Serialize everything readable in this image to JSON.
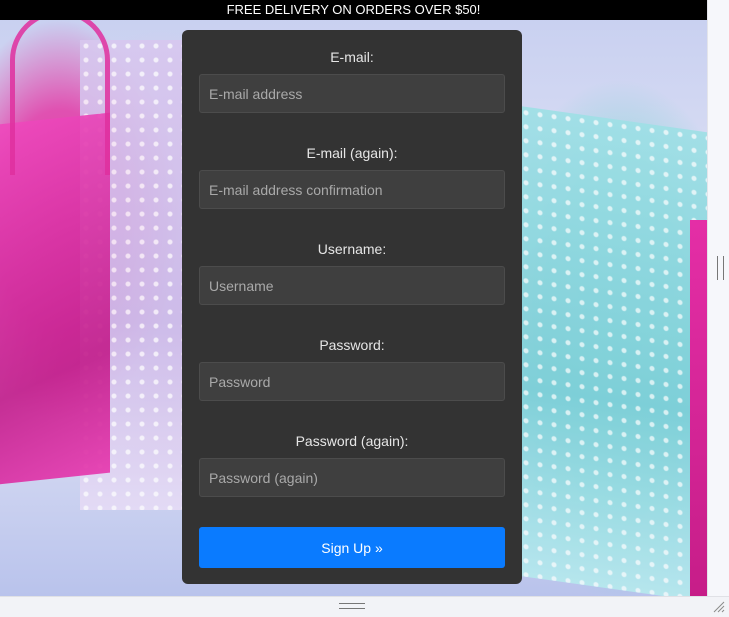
{
  "promo": {
    "text": "FREE DELIVERY ON ORDERS OVER $50!"
  },
  "form": {
    "fields": [
      {
        "label": "E-mail:",
        "placeholder": "E-mail address",
        "value": ""
      },
      {
        "label": "E-mail (again):",
        "placeholder": "E-mail address confirmation",
        "value": ""
      },
      {
        "label": "Username:",
        "placeholder": "Username",
        "value": ""
      },
      {
        "label": "Password:",
        "placeholder": "Password",
        "value": ""
      },
      {
        "label": "Password (again):",
        "placeholder": "Password (again)",
        "value": ""
      }
    ],
    "submit_label": "Sign Up »"
  },
  "colors": {
    "promo_background": "#000000",
    "card_background": "#333333",
    "input_background": "#3f3f3f",
    "accent": "#0a7bff"
  },
  "icons": [
    "vertical-resize-grip-icon",
    "horizontal-resize-grip-icon",
    "corner-resize-icon"
  ]
}
